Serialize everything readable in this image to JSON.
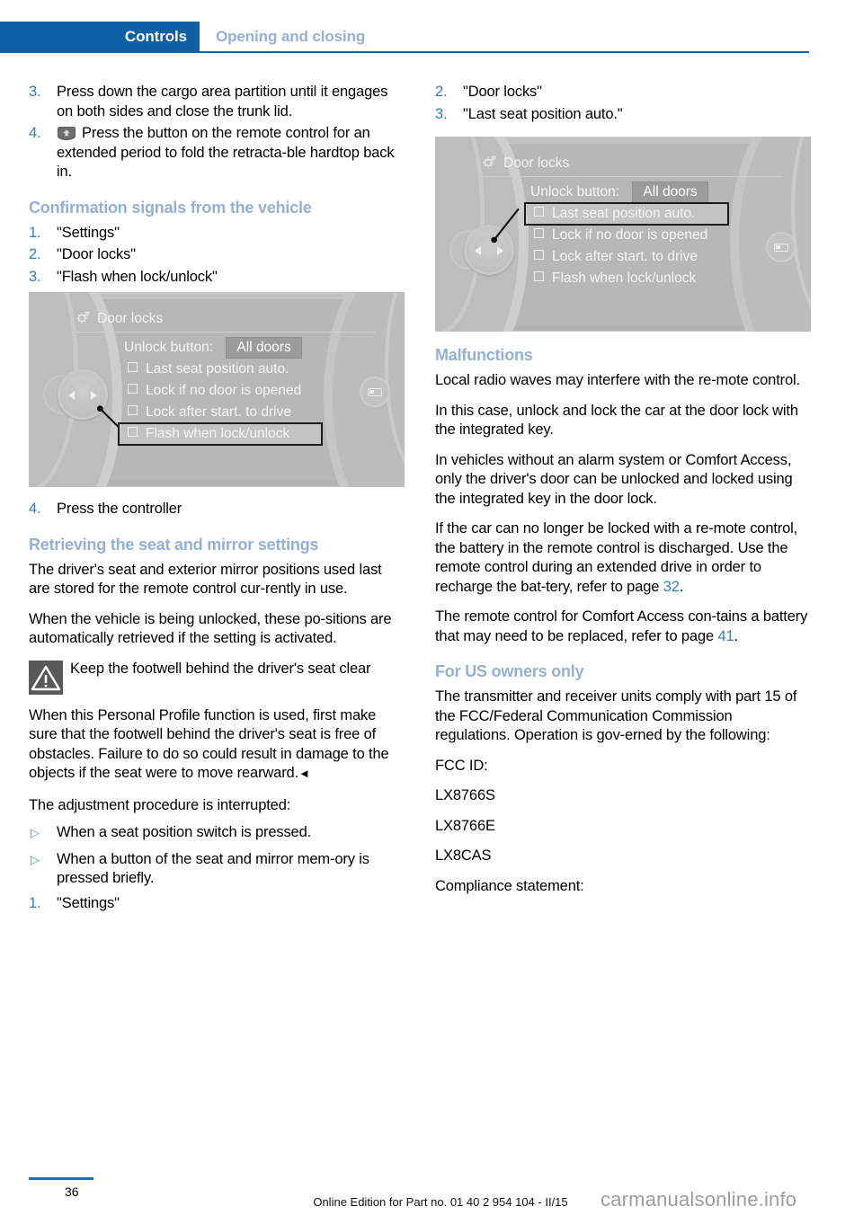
{
  "header": {
    "chapter": "Controls",
    "section": "Opening and closing"
  },
  "left_column": {
    "steps_top": [
      {
        "marker": "3.",
        "text": "Press down the cargo area partition until it engages on both sides and close the trunk lid."
      },
      {
        "marker": "4.",
        "icon": "retractable-hardtop-button-icon",
        "text": "Press the button on the remote control for an extended period to fold the retracta‑ble hardtop back in."
      }
    ],
    "heading_confirmation": "Confirmation signals from the vehicle",
    "confirmation_steps": [
      {
        "marker": "1.",
        "text": "\"Settings\""
      },
      {
        "marker": "2.",
        "text": "\"Door locks\""
      },
      {
        "marker": "3.",
        "text": "\"Flash when lock/unlock\""
      }
    ],
    "figure": {
      "title": "Door locks",
      "title_icon": "gear-icon",
      "unlock_label": "Unlock button:",
      "unlock_value": "All doors",
      "options": [
        {
          "label": "Last seat position auto.",
          "checked": false,
          "highlighted": false
        },
        {
          "label": "Lock if no door is opened",
          "checked": false,
          "highlighted": false
        },
        {
          "label": "Lock after start. to drive",
          "checked": false,
          "highlighted": false
        },
        {
          "label": "Flash when lock/unlock",
          "checked": false,
          "highlighted": true
        }
      ]
    },
    "step_after_figure": {
      "marker": "4.",
      "text": "Press the controller"
    },
    "heading_retrieving": "Retrieving the seat and mirror settings",
    "paras_retrieving": [
      "The driver's seat and exterior mirror positions used last are stored for the remote control cur‑rently in use.",
      "When the vehicle is being unlocked, these po‑sitions are automatically retrieved if the setting is activated."
    ],
    "warning": {
      "icon": "warning-triangle-icon",
      "title": "Keep the footwell behind the driver's seat clear",
      "body": "When this Personal Profile function is used, first make sure that the footwell behind the driver's seat is free of obstacles. Failure to do so could result in damage to the objects if the seat were to move rearward.",
      "endmark": "◄"
    },
    "interrupt_intro": "The adjustment procedure is interrupted:",
    "interrupt_items": [
      {
        "marker": "▷",
        "text": "When a seat position switch is pressed."
      },
      {
        "marker": "▷",
        "text": "When a button of the seat and mirror mem‑ory is pressed briefly."
      }
    ],
    "final_step": {
      "marker": "1.",
      "text": "\"Settings\""
    }
  },
  "right_column": {
    "steps_top": [
      {
        "marker": "2.",
        "text": "\"Door locks\""
      },
      {
        "marker": "3.",
        "text": "\"Last seat position auto.\""
      }
    ],
    "figure": {
      "title": "Door locks",
      "title_icon": "gear-icon",
      "unlock_label": "Unlock button:",
      "unlock_value": "All doors",
      "options": [
        {
          "label": "Last seat position auto.",
          "checked": false,
          "highlighted": true
        },
        {
          "label": "Lock if no door is opened",
          "checked": false,
          "highlighted": false
        },
        {
          "label": "Lock after start. to drive",
          "checked": false,
          "highlighted": false
        },
        {
          "label": "Flash when lock/unlock",
          "checked": false,
          "highlighted": false
        }
      ]
    },
    "heading_malfunctions": "Malfunctions",
    "paras_malfunctions": [
      "Local radio waves may interfere with the re‑mote control.",
      "In this case, unlock and lock the car at the door lock with the integrated key.",
      "In vehicles without an alarm system or Comfort Access, only the driver's door can be unlocked and locked using the integrated key in the door lock."
    ],
    "battery_para_before": "If the car can no longer be locked with a re‑mote control, the battery in the remote control is discharged. Use the remote control during an extended drive in order to recharge the bat‑tery, refer to page ",
    "battery_page_ref": "32",
    "battery_para_after": ".",
    "comfort_para_before": "The remote control for Comfort Access con‑tains a battery that may need to be replaced, refer to page ",
    "comfort_page_ref": "41",
    "comfort_para_after": ".",
    "heading_us_owners": "For US owners only",
    "us_para": "The transmitter and receiver units comply with part 15 of the FCC/Federal Communication Commission regulations. Operation is gov‑erned by the following:",
    "fcc_label": "FCC ID:",
    "fcc_ids": [
      "LX8766S",
      "LX8766E",
      "LX8CAS"
    ],
    "compliance_label": "Compliance statement:"
  },
  "footer": {
    "page_number": "36",
    "edition": "Online Edition for Part no. 01 40 2 954 104 - II/15",
    "watermark": "carmanualsonline.info"
  },
  "colors": {
    "chapter_blue": "#0e60a4",
    "section_blue": "#93b0d6",
    "heading_blue": "#93b0d6",
    "marker_blue": "#2f7ec1",
    "link_blue": "#2f7ec1",
    "rule_blue": "#0f62a8",
    "warning_gray": "#595959"
  }
}
